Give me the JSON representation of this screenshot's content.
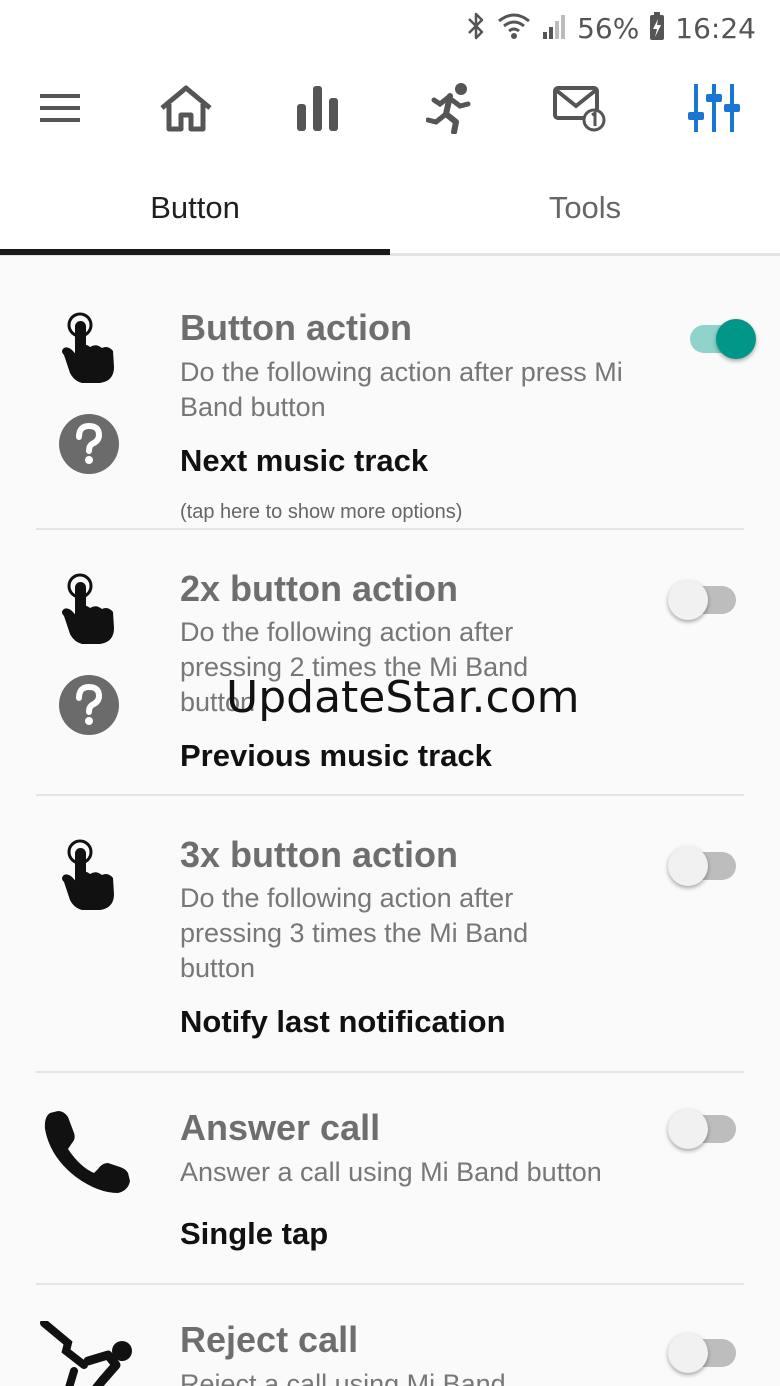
{
  "statusbar": {
    "battery_percent": "56%",
    "time": "16:24",
    "icons": [
      "bluetooth-icon",
      "wifi-icon",
      "signal-icon",
      "battery-charging-icon"
    ]
  },
  "toolbar": {
    "active_color": "#1976d2",
    "icons": [
      "menu-icon",
      "home-icon",
      "bar-chart-icon",
      "running-icon",
      "notification-mail-icon",
      "equalizer-settings-icon"
    ]
  },
  "tabs": [
    {
      "label": "Button",
      "active": true
    },
    {
      "label": "Tools",
      "active": false
    }
  ],
  "items": [
    {
      "title": "Button action",
      "desc": "Do the following action after press Mi Band button",
      "value": "Next music track",
      "hint": "(tap here to show more options)",
      "enabled": true,
      "icon": "tap-hand-icon"
    },
    {
      "title": "2x button action",
      "desc": "Do the following action after pressing 2 times the Mi Band button",
      "value": "Previous music track",
      "enabled": false,
      "icon": "tap-hand-icon"
    },
    {
      "title": "3x button action",
      "desc": "Do the following action after pressing 3 times the Mi Band button",
      "value": "Notify last notification",
      "enabled": false,
      "icon": "tap-hand-icon"
    },
    {
      "title": "Answer call",
      "desc": "Answer a call using Mi Band button",
      "value": "Single tap",
      "enabled": false,
      "icon": "phone-icon"
    },
    {
      "title": "Reject call",
      "desc": "Reject a call using Mi Band",
      "enabled": false,
      "icon": "reject-call-icon"
    }
  ],
  "watermark": "UpdateStar.com",
  "colors": {
    "accent": "#009688",
    "accent_track": "#8fd3cc",
    "title_gray": "#6e6e6e"
  }
}
